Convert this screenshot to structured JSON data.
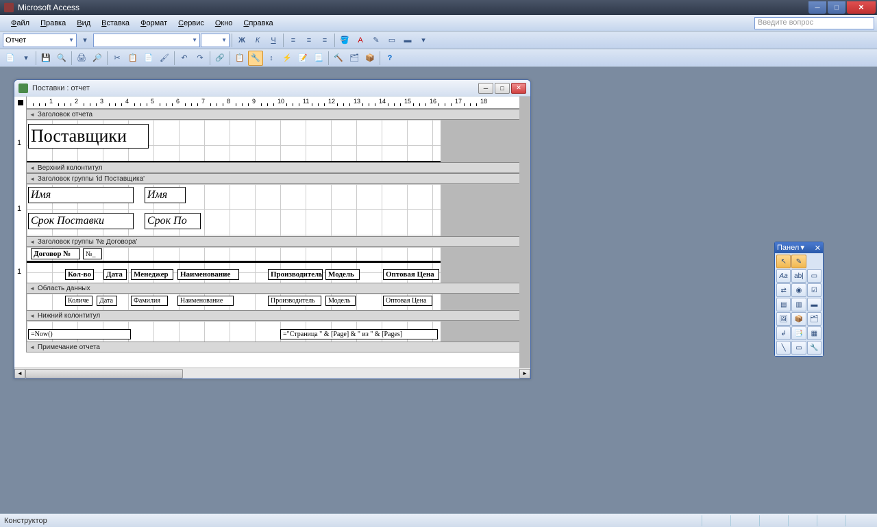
{
  "app": {
    "title": "Microsoft Access"
  },
  "menu": {
    "file": "айл",
    "file_u": "Ф",
    "edit": "равка",
    "edit_u": "П",
    "view": "ид",
    "view_u": "В",
    "insert": "ставка",
    "insert_u": "В",
    "format": "ормат",
    "format_u": "Ф",
    "tools": "ервис",
    "tools_u": "С",
    "window": "кно",
    "window_u": "О",
    "help": "правка",
    "help_u": "С"
  },
  "question_placeholder": "Введите вопрос",
  "fmt": {
    "object": "Отчет",
    "font": "",
    "size": "",
    "bold": "Ж",
    "italic": "К",
    "underline": "Ч"
  },
  "mdi": {
    "title": "Поставки : отчет"
  },
  "sections": {
    "report_header": "Заголовок отчета",
    "page_header": "Верхний колонтитул",
    "group1": "Заголовок группы 'id Поставщика'",
    "group2": "Заголовок группы '№ Договора'",
    "detail": "Область данных",
    "page_footer": "Нижний колонтитул",
    "report_footer": "Примечание отчета"
  },
  "controls": {
    "title": "Поставщики",
    "name_lbl": "Имя",
    "name_fld": "Имя",
    "srok_lbl": "Срок Поставки",
    "srok_fld": "Срок По",
    "dogovor_lbl": "Договор №",
    "dogovor_fld": "№_",
    "cols": [
      "Кол-во",
      "Дата",
      "Менеджер",
      "Наименование",
      "Производитель",
      "Модель",
      "Оптовая Цена"
    ],
    "flds": [
      "Количе",
      "Дата",
      "Фамилия",
      "Наименование",
      "Производитель",
      "Модель",
      "Оптовая Цена"
    ],
    "now": "=Now()",
    "pages": "=\"Страница \" & [Page] & \" из \" & [Pages]"
  },
  "toolbox": {
    "title": "Панел",
    "pointer": "↖",
    "wizard": "✎",
    "label": "Aa",
    "textbox": "ab|"
  },
  "status": {
    "mode": "Конструктор"
  }
}
